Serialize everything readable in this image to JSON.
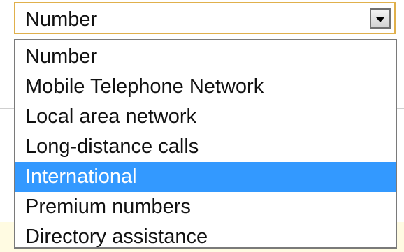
{
  "select": {
    "value": "Number",
    "arrow_icon": "dropdown-arrow-icon"
  },
  "dropdown": {
    "highlighted_option": "International",
    "options": [
      {
        "label": "Number"
      },
      {
        "label": "Mobile Telephone Network"
      },
      {
        "label": "Local area network"
      },
      {
        "label": "Long-distance calls"
      },
      {
        "label": "International"
      },
      {
        "label": "Premium numbers"
      },
      {
        "label": "Directory assistance"
      }
    ]
  },
  "colors": {
    "focus_border": "#e0b04c",
    "highlight": "#3399ff",
    "highlight_text": "#ffffff",
    "page_background_strip": "#fffbe2"
  }
}
